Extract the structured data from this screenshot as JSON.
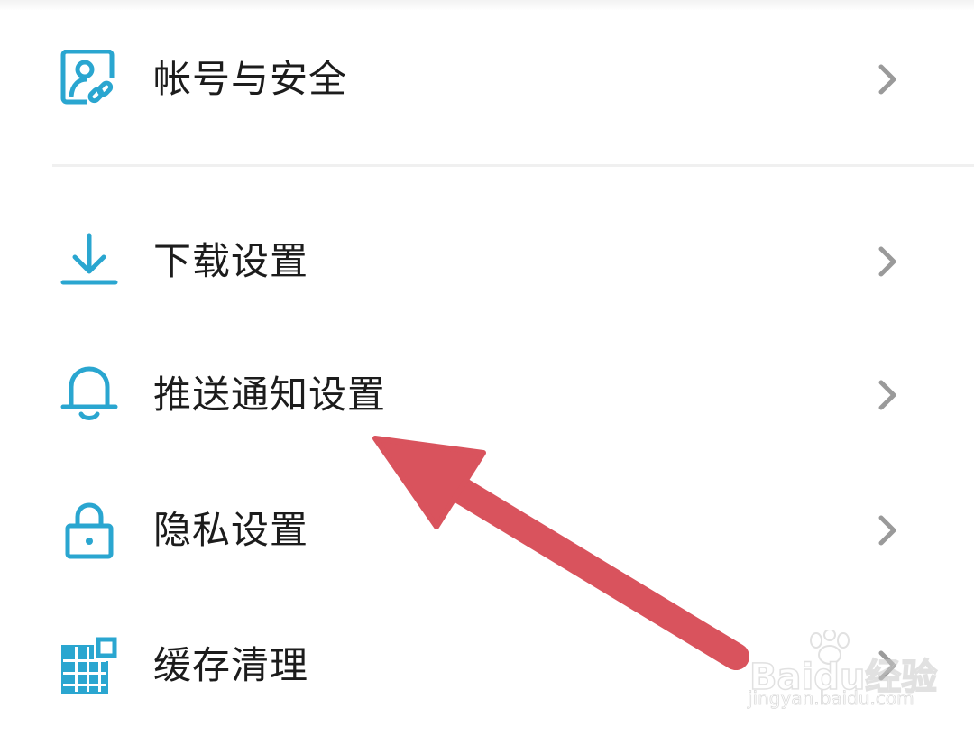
{
  "settings": {
    "items": [
      {
        "label": "帐号与安全",
        "icon": "account-security-icon"
      },
      {
        "label": "下载设置",
        "icon": "download-icon"
      },
      {
        "label": "推送通知设置",
        "icon": "bell-icon"
      },
      {
        "label": "隐私设置",
        "icon": "lock-icon"
      },
      {
        "label": "缓存清理",
        "icon": "cache-grid-icon"
      }
    ]
  },
  "colors": {
    "icon_accent": "#2aa6d0",
    "chevron": "#9a9a9a",
    "annotation_arrow": "#d9535d",
    "text": "#1c1c1c"
  },
  "watermark": {
    "logo_text": "Baidu经验",
    "url": "jingyan.baidu.com"
  }
}
